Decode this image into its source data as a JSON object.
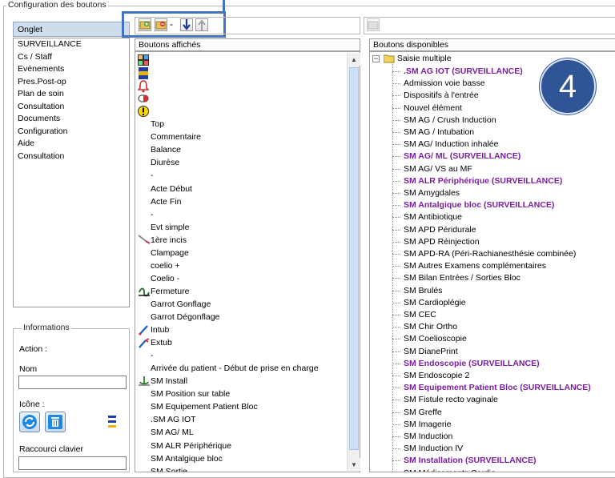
{
  "config_group": {
    "title": "Configuration des boutons"
  },
  "onglet": {
    "header": "Onglet",
    "items": [
      "SURVEILLANCE",
      "Cs / Staff",
      "Evénements",
      "Pres.Post-op",
      "Plan de soin",
      "Consultation",
      "Documents",
      "Configuration",
      "Aide",
      "Consultation"
    ]
  },
  "informations": {
    "title": "Informations",
    "action_label": "Action :",
    "nom_label": "Nom",
    "nom_value": "",
    "icone_label": "Icône :",
    "raccourci_label": "Raccourci clavier",
    "raccourci_value": ""
  },
  "toolbar_left": {
    "separator": "-"
  },
  "boutons_affiches": {
    "header": "Boutons affichés",
    "items": [
      {
        "label": "",
        "icon": "grid-color-icon"
      },
      {
        "label": "",
        "icon": "flag-blue-yellow-icon"
      },
      {
        "label": "",
        "icon": "alarm-bell-icon"
      },
      {
        "label": "",
        "icon": "capsule-pill-icon"
      },
      {
        "label": "",
        "icon": "warning-exclamation-icon"
      },
      {
        "label": "Top",
        "icon": ""
      },
      {
        "label": "Commentaire",
        "icon": ""
      },
      {
        "label": "Balance",
        "icon": ""
      },
      {
        "label": "Diurèse",
        "icon": ""
      },
      {
        "label": "-",
        "icon": ""
      },
      {
        "label": "Acte Début",
        "icon": ""
      },
      {
        "label": "Acte Fin",
        "icon": ""
      },
      {
        "label": "-",
        "icon": ""
      },
      {
        "label": "Evt simple",
        "icon": ""
      },
      {
        "label": "1ère incis",
        "icon": "scalpel-icon"
      },
      {
        "label": "Clampage",
        "icon": ""
      },
      {
        "label": "coelio +",
        "icon": ""
      },
      {
        "label": "Coelio -",
        "icon": ""
      },
      {
        "label": "Fermeture",
        "icon": "suture-icon"
      },
      {
        "label": "Garrot Gonflage",
        "icon": ""
      },
      {
        "label": "Garrot Dégonflage",
        "icon": ""
      },
      {
        "label": "Intub",
        "icon": "intubation-icon"
      },
      {
        "label": "Extub",
        "icon": "extubation-icon"
      },
      {
        "label": "-",
        "icon": ""
      },
      {
        "label": "Arrivée du patient - Début de prise en charge",
        "icon": ""
      },
      {
        "label": "SM Install",
        "icon": "install-anchor-icon"
      },
      {
        "label": "SM Position sur table",
        "icon": ""
      },
      {
        "label": "SM Equipement Patient Bloc",
        "icon": ""
      },
      {
        "label": ".SM AG IOT",
        "icon": ""
      },
      {
        "label": "SM AG/ ML",
        "icon": ""
      },
      {
        "label": "SM ALR Périphérique",
        "icon": ""
      },
      {
        "label": "SM Antalgique bloc",
        "icon": ""
      },
      {
        "label": "SM Sortie",
        "icon": ""
      }
    ]
  },
  "boutons_disponibles": {
    "header": "Boutons disponibles",
    "root_label": "Saisie multiple",
    "items": [
      {
        "label": ".SM AG IOT (SURVEILLANCE)",
        "bold": true
      },
      {
        "label": "Admission voie basse",
        "bold": false
      },
      {
        "label": "Dispositifs à l'entrée",
        "bold": false
      },
      {
        "label": "Nouvel élément",
        "bold": false
      },
      {
        "label": "SM AG / Crush Induction",
        "bold": false
      },
      {
        "label": "SM AG / Intubation",
        "bold": false
      },
      {
        "label": "SM AG/ Induction inhalée",
        "bold": false
      },
      {
        "label": "SM AG/ ML (SURVEILLANCE)",
        "bold": true
      },
      {
        "label": "SM AG/ VS au MF",
        "bold": false
      },
      {
        "label": "SM ALR Périphérique (SURVEILLANCE)",
        "bold": true
      },
      {
        "label": "SM Amygdales",
        "bold": false
      },
      {
        "label": "SM Antalgique bloc (SURVEILLANCE)",
        "bold": true
      },
      {
        "label": "SM Antibiotique",
        "bold": false
      },
      {
        "label": "SM APD Péridurale",
        "bold": false
      },
      {
        "label": "SM APD Réinjection",
        "bold": false
      },
      {
        "label": "SM APD-RA (Péri-Rachianesthésie combinée)",
        "bold": false
      },
      {
        "label": "SM Autres Examens complémentaires",
        "bold": false
      },
      {
        "label": "SM Bilan Entrées / Sorties Bloc",
        "bold": false
      },
      {
        "label": "SM Brulés",
        "bold": false
      },
      {
        "label": "SM Cardioplégie",
        "bold": false
      },
      {
        "label": "SM CEC",
        "bold": false
      },
      {
        "label": "SM Chir Ortho",
        "bold": false
      },
      {
        "label": "SM Coelioscopie",
        "bold": false
      },
      {
        "label": "SM DianePrint",
        "bold": false
      },
      {
        "label": "SM Endoscopie (SURVEILLANCE)",
        "bold": true
      },
      {
        "label": "SM Endoscopie 2",
        "bold": false
      },
      {
        "label": "SM Equipement Patient Bloc (SURVEILLANCE)",
        "bold": true
      },
      {
        "label": "SM Fistule recto vaginale",
        "bold": false
      },
      {
        "label": "SM Greffe",
        "bold": false
      },
      {
        "label": "SM Imagerie",
        "bold": false
      },
      {
        "label": "SM Induction",
        "bold": false
      },
      {
        "label": "SM Induction IV",
        "bold": false
      },
      {
        "label": "SM Installation (SURVEILLANCE)",
        "bold": true
      },
      {
        "label": "SM Médicaments Cardio",
        "bold": false
      }
    ]
  },
  "step_badge": "4",
  "colors": {
    "highlight": "#4472c4",
    "badge": "#2f5597",
    "bold_item": "#7b1fa2"
  }
}
